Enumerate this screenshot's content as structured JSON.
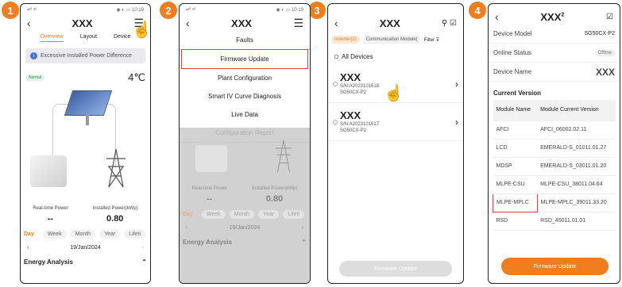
{
  "steps": [
    "1",
    "2",
    "3",
    "4"
  ],
  "status_left": "▪︎ᵃⁱˡ ᵃⁱˡ",
  "status_right": "◉ ◐ ▭ 10:19",
  "p1": {
    "title": "XXX",
    "tabs": [
      "Overview",
      "Layout",
      "Device"
    ],
    "warning": "Excessive Installed Power Difference",
    "normal": "Normal",
    "temp": "4℃",
    "realtime_label": "Real-time Power",
    "installed_label": "Installed Power(kWp)",
    "realtime_value": "--",
    "installed_value": "0.80",
    "date_tabs": [
      "Day",
      "Week",
      "Month",
      "Year",
      "Lifeti"
    ],
    "date": "19/Jan/2024",
    "energy": "Energy Analysis"
  },
  "p2": {
    "title": "XXX",
    "menu": [
      "Faults",
      "Firmware Update",
      "Plant Configuration",
      "Smart IV Curve Diagnosis",
      "Live Data",
      "Configuration Report"
    ],
    "realtime_label": "Real-time Power",
    "installed_label": "Installed Power(kWp)",
    "realtime_value": "--",
    "installed_value": "0.80",
    "date_tabs": [
      "Day",
      "Week",
      "Month",
      "Year",
      "Lifeti"
    ],
    "date": "19/Jan/2024",
    "energy": "Energy Analysis"
  },
  "p3": {
    "title": "XXX",
    "tab_inverter": "Inverter(2)",
    "tab_comm": "Communication Module(",
    "filter": "Filter",
    "all_devices": "All Devices",
    "devices": [
      {
        "name": "XXX",
        "sn": "S/N:A2023101618",
        "model": "SG50CX-P2"
      },
      {
        "name": "XXX",
        "sn": "S/N:A2023101617",
        "model": "SG50CX-P2"
      }
    ],
    "button": "Firmware Update"
  },
  "p4": {
    "title": "XXX",
    "sup": "2",
    "device_model_label": "Device Model",
    "device_model": "SG50CX-P2",
    "online_label": "Online Status",
    "online": "Offline",
    "device_name_label": "Device Name",
    "device_name": "XXX",
    "current_version": "Current Version",
    "col_module": "Module Name",
    "col_version": "Module Current Version",
    "rows": [
      [
        "AFCI",
        "AFCI_06002.02.11"
      ],
      [
        "LCD",
        "EMERALD-S_01011.01.27"
      ],
      [
        "MDSP",
        "EMERALD-S_03011.01.20"
      ],
      [
        "MLPE-CSU",
        "MLPE-CSU_38011.04.64"
      ],
      [
        "MLPE-MPLC",
        "MLPE-MPLC_39011.33.20"
      ],
      [
        "RSD",
        "RSD_45011.01.01"
      ]
    ],
    "button": "Firmware Update"
  }
}
